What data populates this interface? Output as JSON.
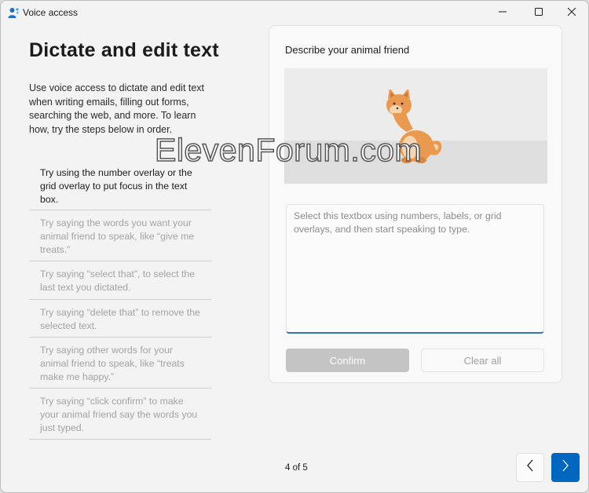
{
  "window": {
    "title": "Voice access",
    "app_icon": "voice-access-icon",
    "controls": [
      "minimize-icon",
      "maximize-icon",
      "close-icon"
    ]
  },
  "left": {
    "heading": "Dictate and edit text",
    "intro": "Use voice access to dictate and edit text when writing emails, filling out forms, searching the web, and more. To learn how, try the steps below in order.",
    "steps": [
      "Try using the number overlay or the grid overlay to put focus in the text box.",
      "Try saying the words you want your animal friend to speak, like “give me treats.”",
      "Try saying “select that”, to select the last text you dictated.",
      "Try saying “delete that” to remove the selected text.",
      "Try saying other words for your animal friend to speak, like “treats make me happy.”",
      "Try saying “click confirm” to make your animal friend say the words you just typed."
    ],
    "active_step_index": 0
  },
  "card": {
    "title": "Describe your animal friend",
    "textbox_placeholder": "Select this textbox using numbers, labels, or grid overlays, and then start speaking to type.",
    "confirm_label": "Confirm",
    "clear_label": "Clear all",
    "confirm_enabled": false
  },
  "footer": {
    "progress": "4 of 5",
    "prev_icon": "chevron-left-icon",
    "next_icon": "chevron-right-icon"
  },
  "watermark": "ElevenForum.com",
  "colors": {
    "accent": "#0067c0",
    "textbox_focus": "#2b77c0",
    "disabled_button": "#c4c4c4",
    "dog": "#e99a4e"
  }
}
